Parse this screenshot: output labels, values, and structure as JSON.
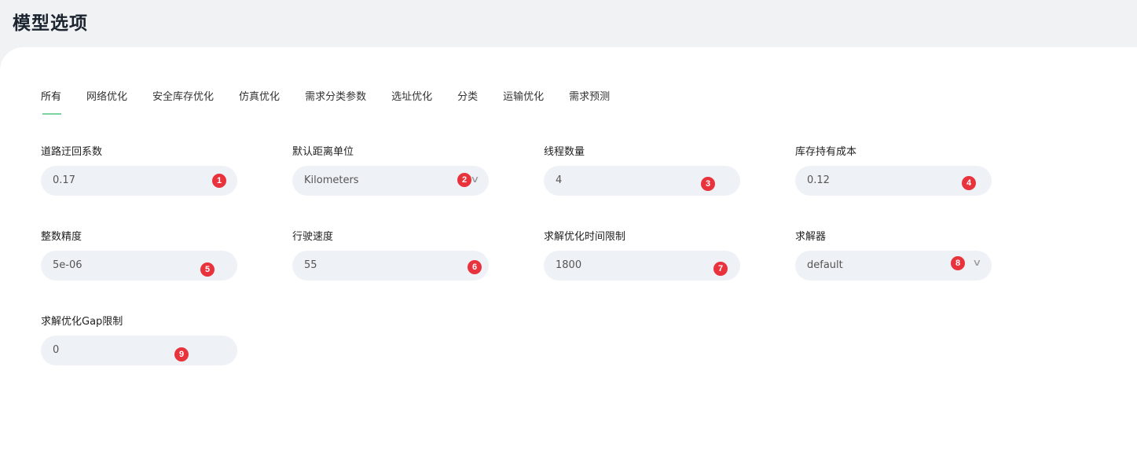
{
  "page": {
    "title": "模型选项"
  },
  "tabs": [
    {
      "label": "所有"
    },
    {
      "label": "网络优化"
    },
    {
      "label": "安全库存优化"
    },
    {
      "label": "仿真优化"
    },
    {
      "label": "需求分类参数"
    },
    {
      "label": "选址优化"
    },
    {
      "label": "分类"
    },
    {
      "label": "运输优化"
    },
    {
      "label": "需求预测"
    }
  ],
  "active_tab": "所有",
  "fields": [
    {
      "label": "道路迂回系数",
      "value": "0.17",
      "badge": "1"
    },
    {
      "label": "默认距离单位",
      "value": "Kilometers",
      "badge": "2",
      "type": "select",
      "icon": "chevron-down-icon"
    },
    {
      "label": "线程数量",
      "value": "4",
      "badge": "3"
    },
    {
      "label": "库存持有成本",
      "value": "0.12",
      "badge": "4"
    },
    {
      "label": "整数精度",
      "value": "5e-06",
      "badge": "5"
    },
    {
      "label": "行驶速度",
      "value": "55",
      "badge": "6"
    },
    {
      "label": "求解优化时间限制",
      "value": "1800",
      "badge": "7"
    },
    {
      "label": "求解器",
      "value": "default",
      "badge": "8",
      "type": "select",
      "icon": "chevron-down-icon"
    },
    {
      "label": "求解优化Gap限制",
      "value": "0",
      "badge": "9"
    }
  ],
  "colors": {
    "background": "#f1f2f4",
    "card": "#ffffff",
    "input_bg": "#eef2f6",
    "badge": "#e8323c",
    "tab_underline": "#7bd3a0"
  }
}
